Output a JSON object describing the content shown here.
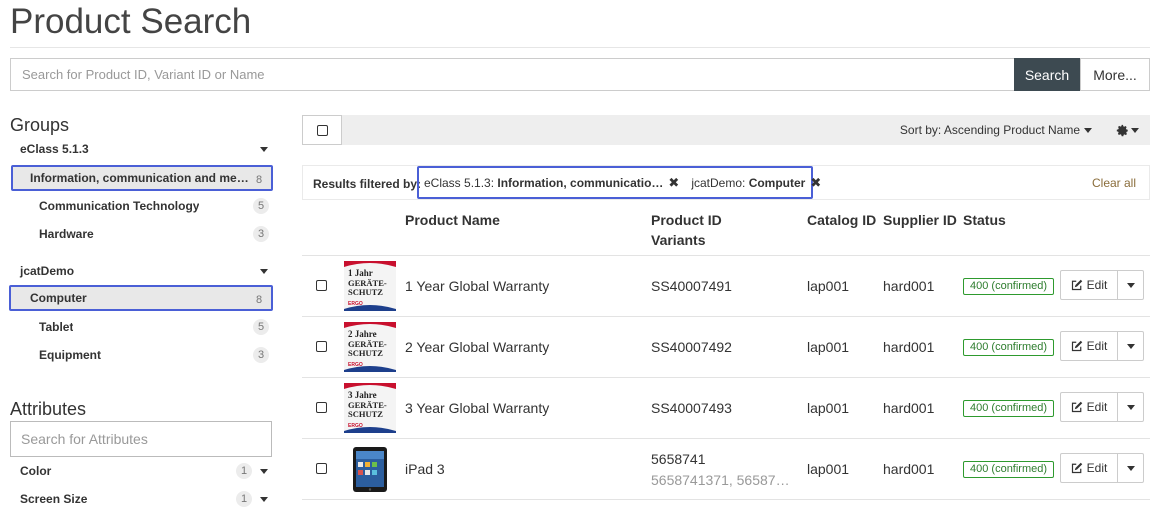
{
  "page_title": "Product Search",
  "search": {
    "placeholder": "Search for Product ID, Variant ID or Name",
    "value": "",
    "search_label": "Search",
    "more_label": "More..."
  },
  "sidebar": {
    "groups_title": "Groups",
    "groups": [
      {
        "name": "eClass 5.1.3",
        "items": [
          {
            "label": "Information, communication and media ...",
            "count": "8",
            "selected": true
          },
          {
            "label": "Communication Technology",
            "count": "5",
            "selected": false
          },
          {
            "label": "Hardware",
            "count": "3",
            "selected": false
          }
        ]
      },
      {
        "name": "jcatDemo",
        "items": [
          {
            "label": "Computer",
            "count": "8",
            "selected": true
          },
          {
            "label": "Tablet",
            "count": "5",
            "selected": false
          },
          {
            "label": "Equipment",
            "count": "3",
            "selected": false
          }
        ]
      }
    ],
    "attributes_title": "Attributes",
    "attributes_placeholder": "Search for Attributes",
    "attributes": [
      {
        "label": "Color",
        "count": "1"
      },
      {
        "label": "Screen Size",
        "count": "1"
      }
    ]
  },
  "toolbar": {
    "sort_label": "Sort by: Ascending Product Name"
  },
  "filters": {
    "label": "Results filtered by:",
    "chips": [
      {
        "key": "eClass 5.1.3:",
        "value": "Information, communicatio…"
      },
      {
        "key": "jcatDemo:",
        "value": "Computer"
      }
    ],
    "clear_all": "Clear all"
  },
  "table": {
    "headers": {
      "name": "Product Name",
      "pid": "Product ID",
      "variants": "Variants",
      "catalog": "Catalog ID",
      "supplier": "Supplier ID",
      "status": "Status"
    },
    "edit_label": "Edit",
    "rows": [
      {
        "thumb_text": [
          "1 Jahr",
          "GERÄTE-",
          "SCHUTZ",
          "ERGO"
        ],
        "name": "1 Year Global Warranty",
        "pid": "SS40007491",
        "variants": "",
        "catalog": "lap001",
        "supplier": "hard001",
        "status": "400 (confirmed)"
      },
      {
        "thumb_text": [
          "2 Jahre",
          "GERÄTE-",
          "SCHUTZ",
          "ERGO"
        ],
        "name": "2 Year Global Warranty",
        "pid": "SS40007492",
        "variants": "",
        "catalog": "lap001",
        "supplier": "hard001",
        "status": "400 (confirmed)"
      },
      {
        "thumb_text": [
          "3 Jahre",
          "GERÄTE-",
          "SCHUTZ",
          "ERGO"
        ],
        "name": "3 Year Global Warranty",
        "pid": "SS40007493",
        "variants": "",
        "catalog": "lap001",
        "supplier": "hard001",
        "status": "400 (confirmed)"
      },
      {
        "thumb_text": [],
        "name": "iPad 3",
        "pid": "5658741",
        "variants": "5658741371, 56587…",
        "catalog": "lap001",
        "supplier": "hard001",
        "status": "400 (confirmed)"
      }
    ]
  },
  "colors": {
    "accent_border": "#4a5fd6",
    "search_button": "#3d4a51",
    "status_green": "#2e9a2e",
    "clear_all": "#8a6d3b"
  }
}
